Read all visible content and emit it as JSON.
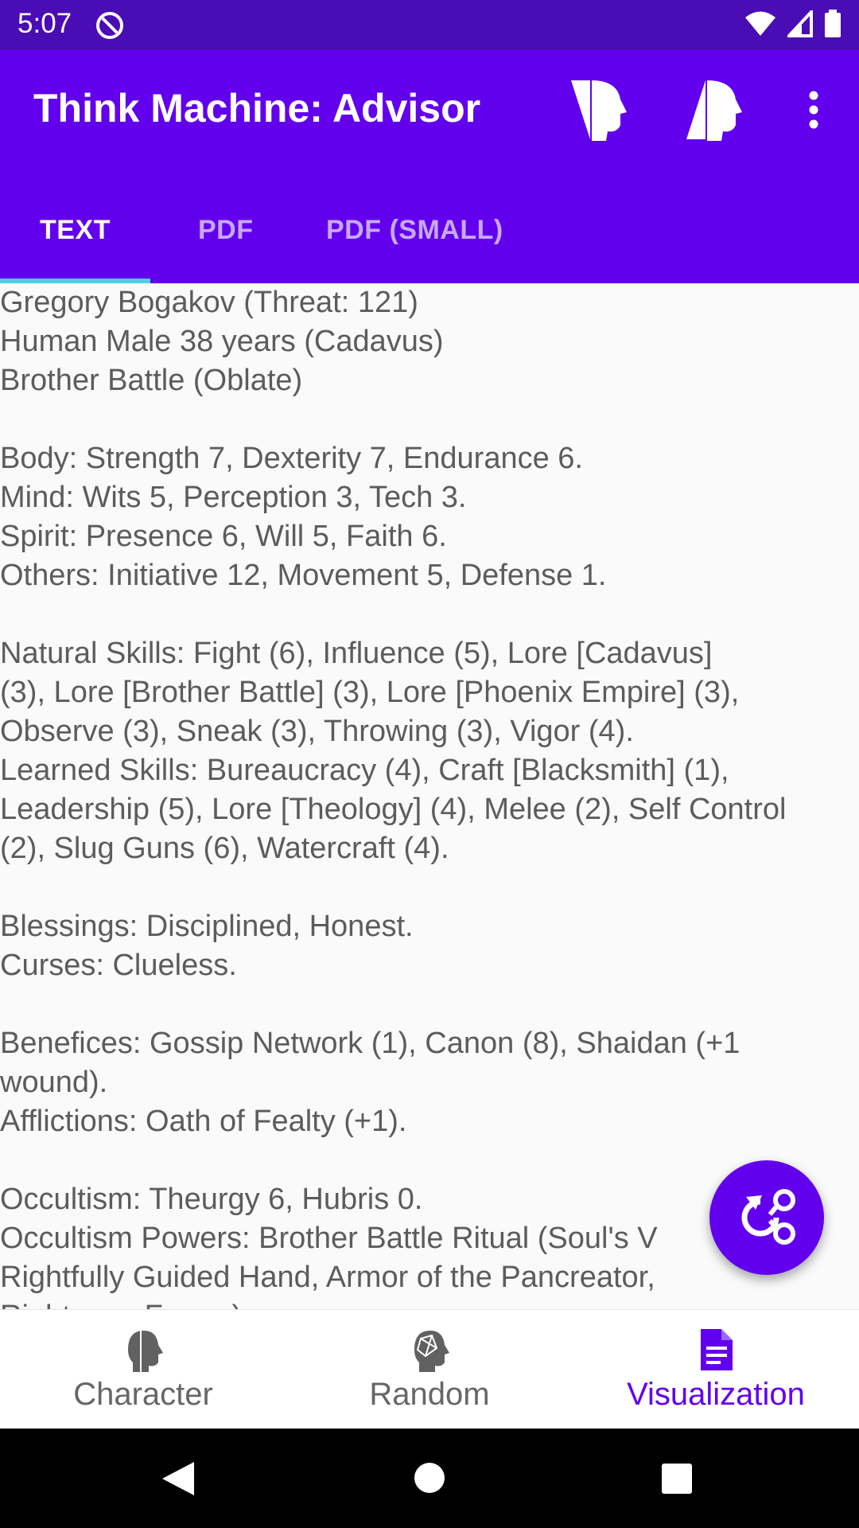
{
  "status_bar": {
    "time": "5:07"
  },
  "app_bar": {
    "title": "Think Machine: Advisor",
    "icons": [
      "head-left-icon",
      "head-right-icon",
      "more-vert-icon"
    ]
  },
  "tabs": [
    {
      "label": "TEXT",
      "selected": true
    },
    {
      "label": "PDF",
      "selected": false
    },
    {
      "label": "PDF (SMALL)",
      "selected": false
    }
  ],
  "content": {
    "lines": [
      "Gregory Bogakov (Threat: 121)",
      "Human Male 38 years (Cadavus)",
      "Brother Battle (Oblate)",
      "",
      "Body: Strength 7, Dexterity 7, Endurance 6.",
      "Mind: Wits 5, Perception 3, Tech 3.",
      "Spirit: Presence 6, Will 5, Faith 6.",
      "Others: Initiative 12, Movement 5, Defense 1.",
      "",
      "Natural Skills: Fight (6), Influence (5), Lore [Cadavus]",
      "(3), Lore [Brother Battle] (3), Lore [Phoenix Empire] (3),",
      "Observe (3), Sneak (3), Throwing (3), Vigor (4).",
      "Learned Skills: Bureaucracy (4), Craft [Blacksmith] (1),",
      "Leadership (5), Lore [Theology] (4), Melee (2), Self Control",
      "(2), Slug Guns (6), Watercraft (4).",
      "",
      "Blessings: Disciplined, Honest.",
      "Curses: Clueless.",
      "",
      "Benefices: Gossip Network (1), Canon (8), Shaidan (+1",
      "wound).",
      "Afflictions: Oath of Fealty (+1).",
      "",
      "Occultism: Theurgy 6, Hubris 0.",
      "Occultism Powers: Brother Battle Ritual (Soul's V",
      "Rightfully Guided Hand, Armor of the Pancreator,",
      "Righteous Fervor)."
    ]
  },
  "fab": {
    "icon": "share-refresh-icon"
  },
  "bottom_nav": [
    {
      "label": "Character",
      "icon": "character-head-icon",
      "selected": false
    },
    {
      "label": "Random",
      "icon": "random-head-icon",
      "selected": false
    },
    {
      "label": "Visualization",
      "icon": "document-icon",
      "selected": true
    }
  ],
  "colors": {
    "primary": "#6200ee",
    "status": "#4a0cb4",
    "indicator": "#4dd0e1"
  }
}
